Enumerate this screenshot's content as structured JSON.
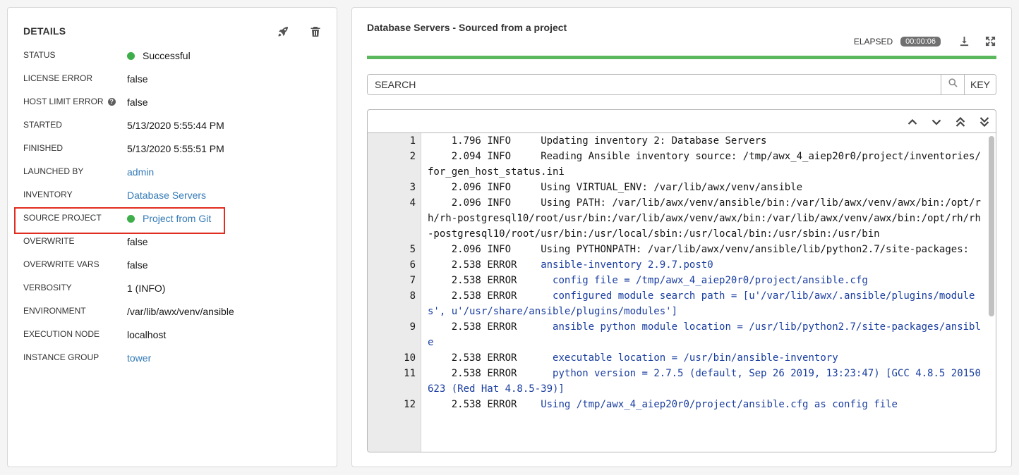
{
  "details": {
    "title": "DETAILS",
    "icons": {
      "launch": "rocket-icon",
      "delete": "trash-icon"
    },
    "rows": [
      {
        "label": "STATUS",
        "value": "Successful",
        "dot": true,
        "link": false
      },
      {
        "label": "LICENSE ERROR",
        "value": "false",
        "dot": false,
        "link": false
      },
      {
        "label": "HOST LIMIT ERROR",
        "value": "false",
        "dot": false,
        "link": false,
        "help": "?"
      },
      {
        "label": "STARTED",
        "value": "5/13/2020 5:55:44 PM",
        "dot": false,
        "link": false
      },
      {
        "label": "FINISHED",
        "value": "5/13/2020 5:55:51 PM",
        "dot": false,
        "link": false
      },
      {
        "label": "LAUNCHED BY",
        "value": "admin",
        "dot": false,
        "link": true
      },
      {
        "label": "INVENTORY",
        "value": "Database Servers",
        "dot": false,
        "link": true
      },
      {
        "label": "SOURCE PROJECT",
        "value": "Project from Git",
        "dot": true,
        "link": true
      },
      {
        "label": "OVERWRITE",
        "value": "false",
        "dot": false,
        "link": false
      },
      {
        "label": "OVERWRITE VARS",
        "value": "false",
        "dot": false,
        "link": false
      },
      {
        "label": "VERBOSITY",
        "value": "1 (INFO)",
        "dot": false,
        "link": false
      },
      {
        "label": "ENVIRONMENT",
        "value": "/var/lib/awx/venv/ansible",
        "dot": false,
        "link": false
      },
      {
        "label": "EXECUTION NODE",
        "value": "localhost",
        "dot": false,
        "link": false
      },
      {
        "label": "INSTANCE GROUP",
        "value": "tower",
        "dot": false,
        "link": true
      }
    ]
  },
  "output": {
    "title": "Database Servers - Sourced from a project",
    "elapsed_label": "ELAPSED",
    "elapsed_value": "00:00:06",
    "progress": 1.0,
    "search_placeholder": "SEARCH",
    "key_label": "KEY",
    "colors": {
      "success": "#5cb85c",
      "status_dot": "#3dae49",
      "link": "#337ab7",
      "highlight": "#e02d1f",
      "error_text": "#1a3ea0"
    },
    "lines": [
      {
        "n": "1",
        "time": "1.796",
        "level": "INFO",
        "msg": "Updating inventory 2: Database Servers"
      },
      {
        "n": "2",
        "time": "2.094",
        "level": "INFO",
        "msg": "Reading Ansible inventory source: /tmp/awx_4_aiep20r0/project/inventories/for_gen_host_status.ini"
      },
      {
        "n": "3",
        "time": "2.096",
        "level": "INFO",
        "msg": "Using VIRTUAL_ENV: /var/lib/awx/venv/ansible"
      },
      {
        "n": "4",
        "time": "2.096",
        "level": "INFO",
        "msg": "Using PATH: /var/lib/awx/venv/ansible/bin:/var/lib/awx/venv/awx/bin:/opt/rh/rh-postgresql10/root/usr/bin:/var/lib/awx/venv/awx/bin:/var/lib/awx/venv/awx/bin:/opt/rh/rh-postgresql10/root/usr/bin:/usr/local/sbin:/usr/local/bin:/usr/sbin:/usr/bin"
      },
      {
        "n": "5",
        "time": "2.096",
        "level": "INFO",
        "msg": "Using PYTHONPATH: /var/lib/awx/venv/ansible/lib/python2.7/site-packages:"
      },
      {
        "n": "6",
        "time": "2.538",
        "level": "ERROR",
        "msg": "ansible-inventory 2.9.7.post0"
      },
      {
        "n": "7",
        "time": "2.538",
        "level": "ERROR",
        "msg": "  config file = /tmp/awx_4_aiep20r0/project/ansible.cfg"
      },
      {
        "n": "8",
        "time": "2.538",
        "level": "ERROR",
        "msg": "  configured module search path = [u'/var/lib/awx/.ansible/plugins/modules', u'/usr/share/ansible/plugins/modules']"
      },
      {
        "n": "9",
        "time": "2.538",
        "level": "ERROR",
        "msg": "  ansible python module location = /usr/lib/python2.7/site-packages/ansible"
      },
      {
        "n": "10",
        "time": "2.538",
        "level": "ERROR",
        "msg": "  executable location = /usr/bin/ansible-inventory"
      },
      {
        "n": "11",
        "time": "2.538",
        "level": "ERROR",
        "msg": "  python version = 2.7.5 (default, Sep 26 2019, 13:23:47) [GCC 4.8.5 20150623 (Red Hat 4.8.5-39)]"
      },
      {
        "n": "12",
        "time": "2.538",
        "level": "ERROR",
        "msg": "Using /tmp/awx_4_aiep20r0/project/ansible.cfg as config file"
      }
    ]
  }
}
